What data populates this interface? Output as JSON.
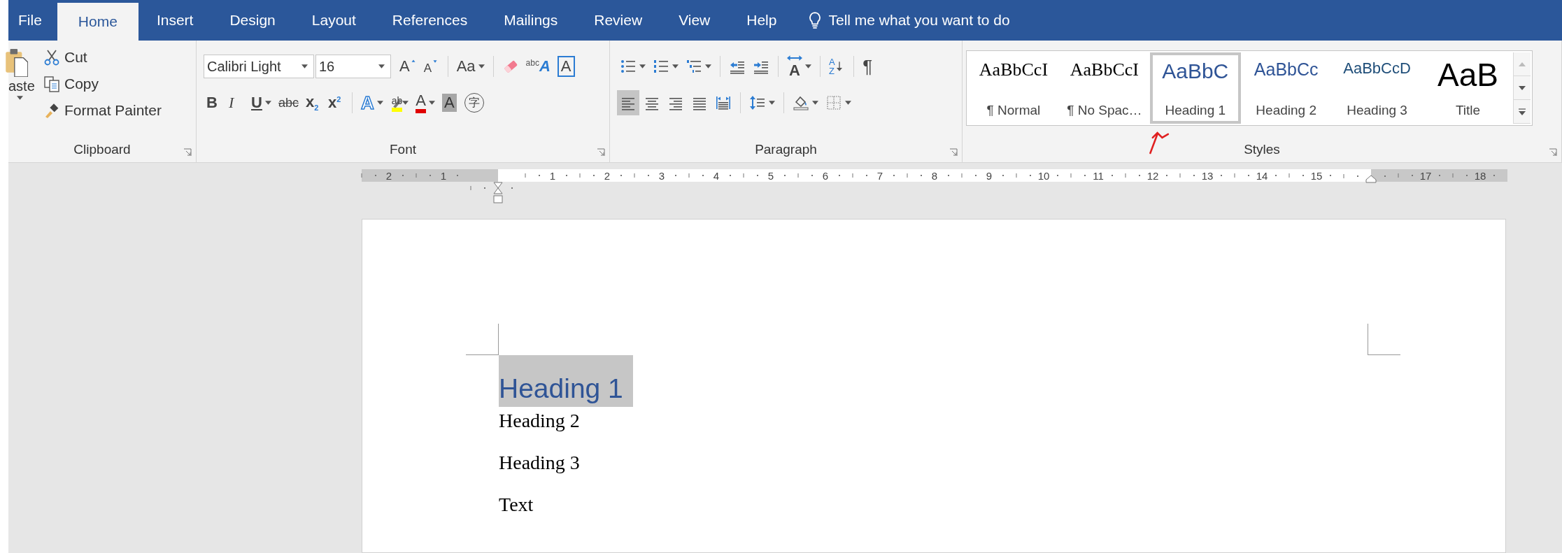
{
  "tabs": [
    {
      "label": "File",
      "selected": false
    },
    {
      "label": "Home",
      "selected": true
    },
    {
      "label": "Insert",
      "selected": false
    },
    {
      "label": "Design",
      "selected": false
    },
    {
      "label": "Layout",
      "selected": false
    },
    {
      "label": "References",
      "selected": false
    },
    {
      "label": "Mailings",
      "selected": false
    },
    {
      "label": "Review",
      "selected": false
    },
    {
      "label": "View",
      "selected": false
    },
    {
      "label": "Help",
      "selected": false
    }
  ],
  "tell_me": {
    "placeholder": "Tell me what you want to do"
  },
  "clipboard": {
    "label": "Clipboard",
    "paste": {
      "label": "aste"
    },
    "actions": [
      {
        "kind": "cut",
        "label": "Cut"
      },
      {
        "kind": "copy",
        "label": "Copy"
      },
      {
        "kind": "format-painter",
        "label": "Format Painter"
      }
    ]
  },
  "font": {
    "label": "Font",
    "font_name": "Calibri Light",
    "font_size": "16",
    "row1": [
      {
        "kind": "grow",
        "label": "A"
      },
      {
        "kind": "shrink",
        "label": "A"
      },
      {
        "kind": "separator"
      },
      {
        "kind": "case",
        "label": "Aa",
        "dropdown": true
      },
      {
        "kind": "separator"
      },
      {
        "kind": "clear"
      },
      {
        "kind": "phonetic",
        "label": "$^{abc}$A"
      },
      {
        "kind": "char-border",
        "label": "A"
      }
    ],
    "row2": [
      {
        "kind": "bold",
        "label": "B"
      },
      {
        "kind": "italic",
        "label": "I"
      },
      {
        "kind": "underline",
        "label": "U",
        "dropdown": true
      },
      {
        "kind": "strike",
        "label": "abc"
      },
      {
        "kind": "subscript",
        "label": "x$_{2}$"
      },
      {
        "kind": "superscript",
        "label": "x$^{2}$"
      },
      {
        "kind": "separator"
      },
      {
        "kind": "text-effects",
        "label": "A",
        "dropdown": true
      },
      {
        "kind": "highlight",
        "label": "ab",
        "dropdown": true
      },
      {
        "kind": "font-color",
        "label": "A",
        "dropdown": true
      },
      {
        "kind": "shading-char",
        "label": "A"
      },
      {
        "kind": "enclose",
        "label": "字"
      }
    ]
  },
  "paragraph": {
    "label": "Paragraph",
    "row1": [
      {
        "kind": "bullets",
        "dropdown": true
      },
      {
        "kind": "numbering",
        "dropdown": true
      },
      {
        "kind": "multilevel",
        "dropdown": true
      },
      {
        "kind": "separator"
      },
      {
        "kind": "decrease-indent"
      },
      {
        "kind": "increase-indent"
      },
      {
        "kind": "separator"
      },
      {
        "kind": "text-direction",
        "label": "A",
        "dropdown": true
      },
      {
        "kind": "separator"
      },
      {
        "kind": "sort",
        "label": "AZ"
      },
      {
        "kind": "separator"
      },
      {
        "kind": "pilcrow",
        "label": "¶"
      }
    ],
    "row2": [
      {
        "kind": "align-left",
        "selected": true
      },
      {
        "kind": "align-center",
        "selected": false
      },
      {
        "kind": "align-right",
        "selected": false
      },
      {
        "kind": "justify",
        "selected": false
      },
      {
        "kind": "distributed",
        "selected": false
      },
      {
        "kind": "separator"
      },
      {
        "kind": "line-spacing",
        "dropdown": true
      },
      {
        "kind": "separator"
      },
      {
        "kind": "shading",
        "dropdown": true
      },
      {
        "kind": "borders",
        "dropdown": true
      }
    ]
  },
  "styles": {
    "label": "Styles",
    "items": [
      {
        "preview": "AaBbCcI",
        "label": "¶ Normal",
        "kind": "body",
        "selected": false
      },
      {
        "preview": "AaBbCcI",
        "label": "¶ No Spac…",
        "kind": "body",
        "selected": false
      },
      {
        "preview": "AaBbC",
        "label": "Heading 1",
        "kind": "heading1",
        "selected": true
      },
      {
        "preview": "AaBbCc",
        "label": "Heading 2",
        "kind": "heading2",
        "selected": false
      },
      {
        "preview": "AaBbCcD",
        "label": "Heading 3",
        "kind": "heading3",
        "selected": false
      },
      {
        "preview": "AaB",
        "label": "Title",
        "kind": "title",
        "selected": false
      }
    ]
  },
  "ruler": {
    "marks": [
      {
        "kind": "number",
        "label": "2",
        "margin": true
      },
      {
        "kind": "number",
        "label": "1",
        "margin": true
      },
      {
        "kind": "first-indent"
      },
      {
        "kind": "number",
        "label": "1",
        "margin": false
      },
      {
        "kind": "number",
        "label": "2",
        "margin": false
      },
      {
        "kind": "number",
        "label": "3",
        "margin": false
      },
      {
        "kind": "number",
        "label": "4",
        "margin": false
      },
      {
        "kind": "number",
        "label": "5",
        "margin": false
      },
      {
        "kind": "number",
        "label": "6",
        "margin": false
      },
      {
        "kind": "number",
        "label": "7",
        "margin": false
      },
      {
        "kind": "number",
        "label": "8",
        "margin": false
      },
      {
        "kind": "number",
        "label": "9",
        "margin": false
      },
      {
        "kind": "number",
        "label": "10",
        "margin": false
      },
      {
        "kind": "number",
        "label": "11",
        "margin": false
      },
      {
        "kind": "number",
        "label": "12",
        "margin": false
      },
      {
        "kind": "number",
        "label": "13",
        "margin": false
      },
      {
        "kind": "number",
        "label": "14",
        "margin": false
      },
      {
        "kind": "number",
        "label": "15",
        "margin": false
      },
      {
        "kind": "right-indent"
      },
      {
        "kind": "number",
        "label": "17",
        "margin": true
      },
      {
        "kind": "number",
        "label": "18",
        "margin": true
      }
    ]
  },
  "document": {
    "paragraphs": [
      {
        "kind": "heading1",
        "text": "Heading 1",
        "selected": true
      },
      {
        "kind": "heading2",
        "text": "Heading 2",
        "selected": false
      },
      {
        "kind": "heading3",
        "text": "Heading 3",
        "selected": false
      },
      {
        "kind": "body",
        "text": "Text",
        "selected": false
      }
    ]
  }
}
